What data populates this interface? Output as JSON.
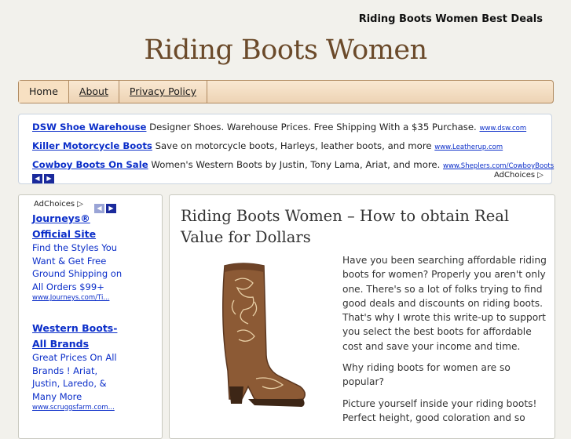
{
  "header": {
    "top_right": "Riding Boots Women Best Deals",
    "site_title": "Riding Boots Women"
  },
  "nav": {
    "items": [
      {
        "label": "Home"
      },
      {
        "label": "About"
      },
      {
        "label": "Privacy Policy"
      }
    ]
  },
  "top_ads": {
    "rows": [
      {
        "title": "DSW Shoe Warehouse",
        "desc": "Designer Shoes. Warehouse Prices. Free Shipping With a $35 Purchase.",
        "url": "www.dsw.com"
      },
      {
        "title": "Killer Motorcycle Boots",
        "desc": "Save on motorcycle boots, Harleys, leather boots, and more",
        "url": "www.Leatherup.com"
      },
      {
        "title": "Cowboy Boots On Sale",
        "desc": "Women's Western Boots by Justin, Tony Lama, Ariat, and more.",
        "url": "www.Sheplers.com/CowboyBoots"
      }
    ],
    "adchoices": "AdChoices"
  },
  "sidebar": {
    "adchoices": "AdChoices",
    "ads": [
      {
        "title": "Journeys® Official Site",
        "desc": "Find the Styles You Want & Get Free Ground Shipping on All Orders $99+",
        "url": "www.Journeys.com/Ti..."
      },
      {
        "title": "Western Boots- All Brands",
        "desc": "Great Prices On All Brands ! Ariat, Justin, Laredo, & Many More",
        "url": "www.scruggsfarm.com..."
      }
    ]
  },
  "article": {
    "title": "Riding Boots Women – How to obtain Real Value for Dollars",
    "paragraphs": [
      "Have you been searching affordable riding boots for women? Properly you aren't only one. There's so a lot of folks trying to find good deals and discounts on riding boots. That's why I wrote this write-up to support you select the best boots for affordable cost and save your income and time.",
      "Why riding boots for women are so popular?",
      "Picture yourself inside your riding boots! Perfect height, good coloration and so"
    ]
  },
  "colors": {
    "title_brown": "#6b4a2a",
    "link_blue": "#0b2ec9",
    "nav_bg": "#edd3b4"
  }
}
